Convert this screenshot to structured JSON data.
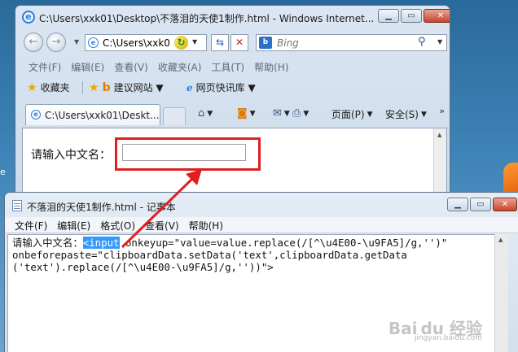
{
  "ie": {
    "title": "C:\\Users\\xxk01\\Desktop\\不落泪的天使1制作.html - Windows Internet...",
    "address": "C:\\Users\\xxk0",
    "search_placeholder": "Bing",
    "menu": [
      "文件(F)",
      "编辑(E)",
      "查看(V)",
      "收藏夹(A)",
      "工具(T)",
      "帮助(H)"
    ],
    "favorites": {
      "label": "收藏夹",
      "items": [
        {
          "label": "建议网站 ▼"
        },
        {
          "label": "网页快讯库 ▼"
        }
      ]
    },
    "tab": {
      "label": "C:\\Users\\xxk01\\Deskt..."
    },
    "commands": {
      "page": "页面(P)",
      "safety": "安全(S)"
    },
    "page": {
      "label": "请输入中文名："
    }
  },
  "notepad": {
    "title": "不落泪的天使1制作.html - 记事本",
    "menu": [
      "文件(F)",
      "编辑(E)",
      "格式(O)",
      "查看(V)",
      "帮助(H)"
    ],
    "line1_prefix": "请输入中文名：",
    "line1_selected": "<input",
    "line1_rest": " onkeyup=\"value=value.replace(/[^\\u4E00-\\u9FA5]/g,'')\"",
    "line2": "onbeforepaste=\"clipboardData.setData('text',clipboardData.getData",
    "line3": "('text').replace(/[^\\u4E00-\\u9FA5]/g,''))\">"
  },
  "watermark": {
    "brand": "Bai du 经验",
    "sub": "jingyan.baidu.com"
  },
  "colors": {
    "annotation": "#e02020",
    "selection": "#3399ff"
  }
}
